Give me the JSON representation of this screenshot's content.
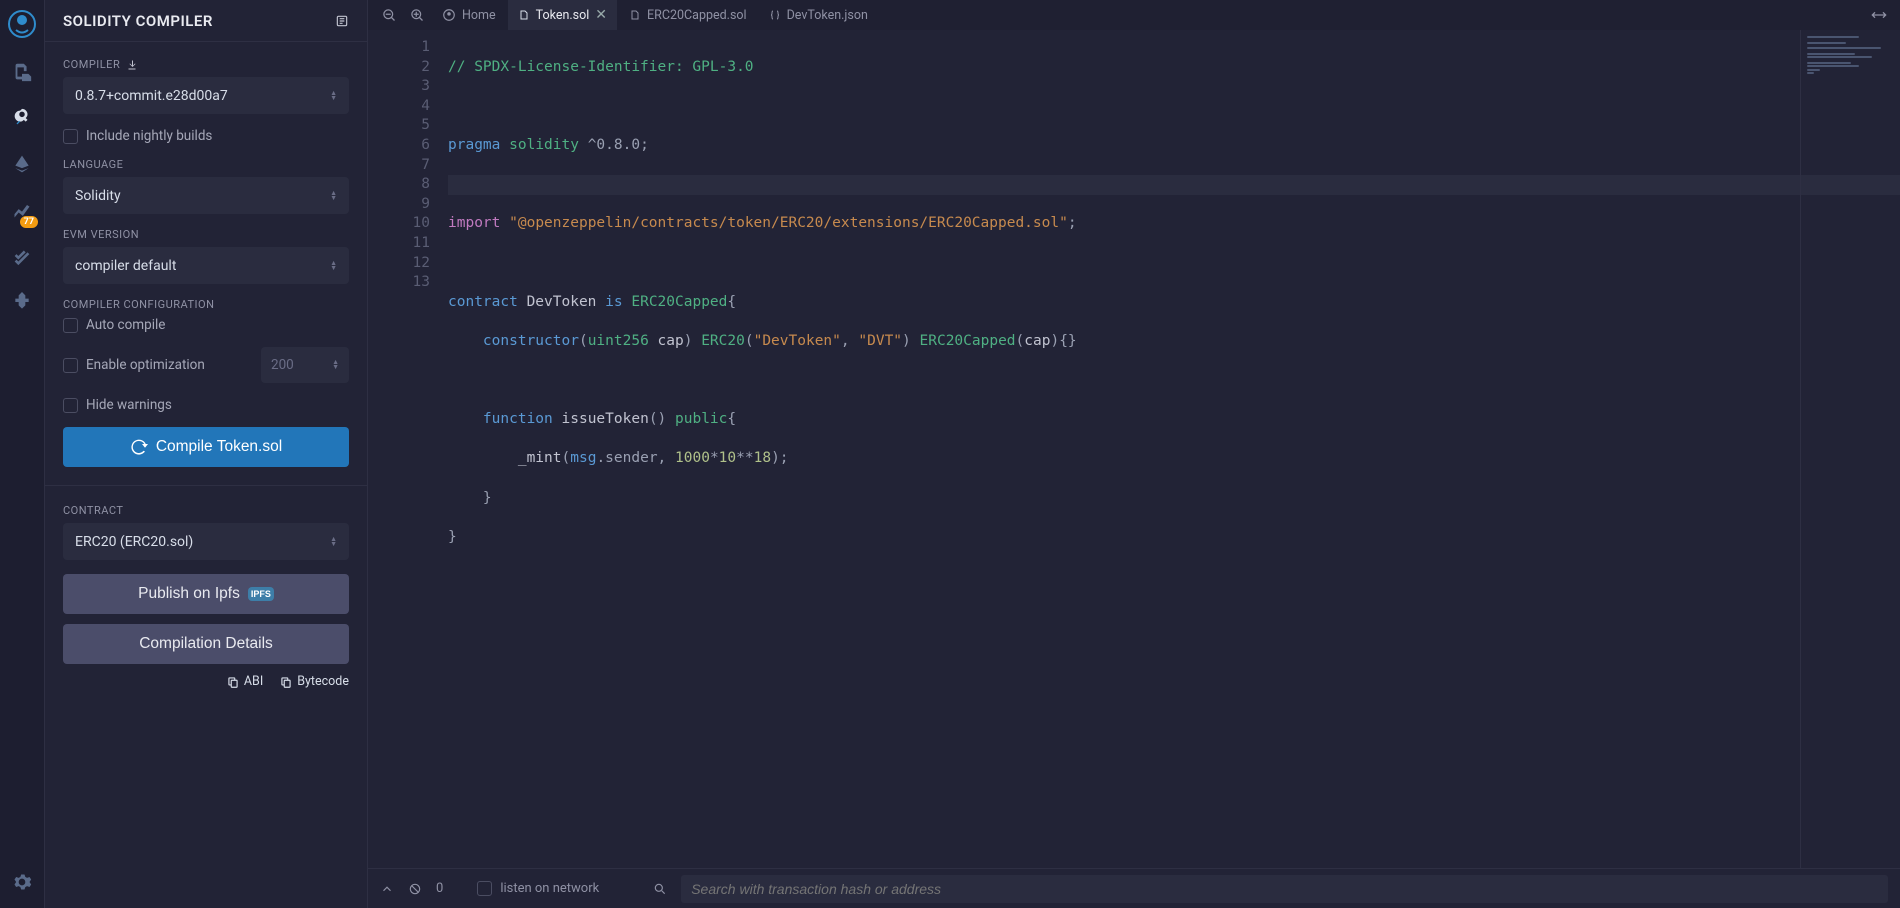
{
  "sidebar": {
    "title": "SOLIDITY COMPILER",
    "compiler_label": "COMPILER",
    "compiler_value": "0.8.7+commit.e28d00a7",
    "nightly_label": "Include nightly builds",
    "language_label": "LANGUAGE",
    "language_value": "Solidity",
    "evm_label": "EVM VERSION",
    "evm_value": "compiler default",
    "config_label": "COMPILER CONFIGURATION",
    "auto_compile_label": "Auto compile",
    "enable_opt_label": "Enable optimization",
    "opt_runs": "200",
    "hide_warnings_label": "Hide warnings",
    "compile_button": "Compile Token.sol",
    "contract_label": "CONTRACT",
    "contract_value": "ERC20 (ERC20.sol)",
    "publish_button": "Publish on Ipfs",
    "details_button": "Compilation Details",
    "abi_link": "ABI",
    "bytecode_link": "Bytecode",
    "badge": "77"
  },
  "tabs": {
    "home": "Home",
    "t1": "Token.sol",
    "t2": "ERC20Capped.sol",
    "t3": "DevToken.json"
  },
  "editor": {
    "lines": [
      "1",
      "2",
      "3",
      "4",
      "5",
      "6",
      "7",
      "8",
      "9",
      "10",
      "11",
      "12",
      "13"
    ]
  },
  "code": {
    "l1": "// SPDX-License-Identifier: GPL-3.0",
    "l3a": "pragma",
    "l3b": "solidity",
    "l3c": "^0.8.0",
    "l5a": "import",
    "l5b": "\"@openzeppelin/contracts/token/ERC20/extensions/ERC20Capped.sol\"",
    "l7a": "contract",
    "l7b": "DevToken",
    "l7c": "is",
    "l7d": "ERC20Capped",
    "l8a": "constructor",
    "l8b": "uint256",
    "l8c": "cap",
    "l8d": "ERC20",
    "l8e": "\"DevToken\"",
    "l8f": "\"DVT\"",
    "l8g": "ERC20Capped",
    "l8h": "cap",
    "l10a": "function",
    "l10b": "issueToken",
    "l10c": "public",
    "l11a": "_mint",
    "l11b": "msg",
    "l11c": ".sender, ",
    "l11d": "1000",
    "l11e": "*",
    "l11f": "10",
    "l11g": "**",
    "l11h": "18"
  },
  "bottom": {
    "count": "0",
    "listen": "listen on network",
    "search_placeholder": "Search with transaction hash or address"
  }
}
